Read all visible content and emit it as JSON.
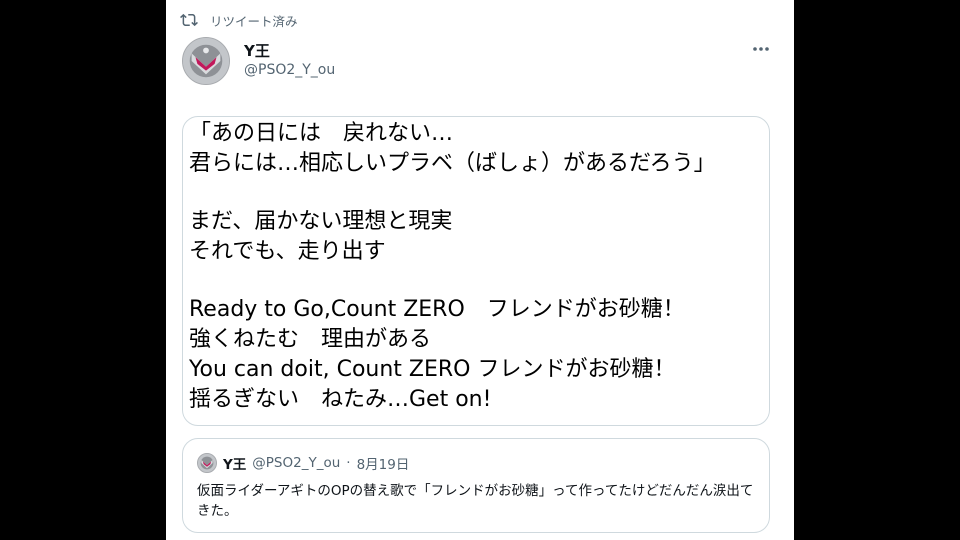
{
  "retweet": {
    "label": "リツイート済み",
    "icon": "retweet-icon"
  },
  "tweet": {
    "display_name": "Y王",
    "handle": "@PSO2_Y_ou",
    "more_icon": "more-options-icon",
    "image_lines": [
      "「あの日には　戻れない…",
      "君らには…相応しいプラベ（ばしょ）があるだろう」",
      "",
      "まだ、届かない理想と現実",
      "それでも、走り出す",
      "",
      "Ready to Go,Count ZERO　フレンドがお砂糖！",
      "強くねたむ　理由がある",
      "You can doit, Count ZERO フレンドがお砂糖！",
      "揺るぎない　ねたみ…Get on!"
    ]
  },
  "quoted": {
    "display_name": "Y王",
    "handle": "@PSO2_Y_ou",
    "separator": "·",
    "date": "8月19日",
    "text": "仮面ライダーアギトのOPの替え歌で「フレンドがお砂糖」って作ってたけどだんだん涙出てきた。"
  },
  "colors": {
    "background": "#000000",
    "panel": "#ffffff",
    "secondary_text": "#536471",
    "border": "#cfd9de"
  }
}
